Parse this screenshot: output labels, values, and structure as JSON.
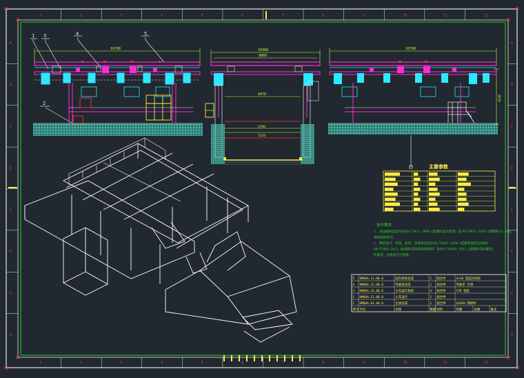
{
  "colors": {
    "background": "#212830",
    "frame": "#e8e8e8",
    "border_green": "#2bd11f",
    "dimension": "#c8ff3c",
    "outline": "#ffffff",
    "magenta": "#ff2bd6",
    "cyan": "#2be8ff",
    "yellow": "#fff04a",
    "red": "#ff3030",
    "ground": "#33b5a5"
  },
  "grid": {
    "columns": [
      "1",
      "2",
      "3",
      "4",
      "5",
      "6",
      "7",
      "8",
      "9",
      "10",
      "11",
      "12"
    ],
    "rows": [
      "A",
      "B",
      "C",
      "D",
      "E",
      "F",
      "G",
      "H"
    ]
  },
  "callouts": [
    "1",
    "3",
    "4",
    "5",
    "2"
  ],
  "dimensions": {
    "left_width": "16790",
    "center_top": "10360",
    "center_inner": "9860",
    "center_span": "6470",
    "right_width": "16790",
    "right_height": "4630",
    "center_low_1": "3790",
    "center_low_2": "5210"
  },
  "params_table": {
    "title": "主要参数",
    "rows": [
      [
        "▆▆▆▆▆▆▆",
        "▆▆",
        "▆▆▆▆",
        "▆▆▆▆▆"
      ],
      [
        "▆▆▆▆▆",
        "▆▆▆",
        "▆▆▆▆▆",
        "▆▆▆▆"
      ],
      [
        "▆▆▆▆▆▆",
        "▆▆",
        "▆▆▆",
        "▆▆▆▆▆▆"
      ],
      [
        "▆▆▆▆",
        "▆▆▆",
        "▆▆▆▆",
        "▆▆▆"
      ],
      [
        "▆▆▆▆▆▆",
        "▆▆",
        "▆▆▆▆▆",
        "▆▆▆▆"
      ],
      [
        "▆▆▆▆▆",
        "▆▆▆",
        "▆▆▆",
        "▆▆▆▆"
      ],
      [
        "▆▆▆▆▆▆▆",
        "▆▆",
        "▆▆▆▆",
        "▆▆▆▆▆"
      ],
      [
        "▆▆▆▆",
        "▆▆▆",
        "▆▆▆▆▆",
        "▆▆▆"
      ]
    ]
  },
  "notes": {
    "title": "技术要求",
    "lines": [
      "1. 本设备制造应符合GB/T3811-2008《起重机设计规范》及JB/T8917-2019《弹簧抓斗》标准",
      "   其余规定执行。",
      "2. 整机设计、制造、安装、验收等应符合GB/T6067-2010《起重机械安全规程》",
      "   GB/T5905-2011《起重机试验规范和程序》及GB/T14405-2011《通用桥式起重机》",
      "   的要求，合格后方可使用。"
    ]
  },
  "bom": {
    "rows": [
      [
        "5",
        "HM60A.11.00.0",
        "起升机构总成",
        "2",
        "组合件",
        "4×30 型起升机构"
      ],
      [
        "4",
        "HM60A.12.00.0",
        "驾驶室总成",
        "1",
        "组合件",
        "驾驶室 空调"
      ],
      [
        "3",
        "HM60A.31.00.0",
        "大车运行机构",
        "4",
        "组合件",
        "YZR 电机"
      ],
      [
        "2",
        "HM60A.21.00.0",
        "小车运行",
        "1",
        "组合件",
        ""
      ],
      [
        "1",
        "HM60A.01.00.0",
        "主梁总成",
        "1",
        "组合件",
        "Q345B 焊接件"
      ]
    ],
    "header": [
      "序号",
      "代号",
      "名称",
      "数量",
      "材料",
      "单重",
      "总重",
      "备注"
    ]
  }
}
